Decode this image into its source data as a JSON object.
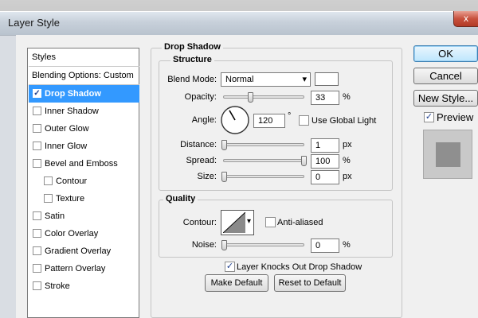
{
  "window": {
    "title": "Layer Style",
    "close_glyph": "x"
  },
  "sidebar": {
    "header": "Styles",
    "blending": "Blending Options: Custom",
    "items": [
      {
        "label": "Drop Shadow",
        "checked": true,
        "selected": true,
        "indent": false
      },
      {
        "label": "Inner Shadow",
        "checked": false,
        "indent": false
      },
      {
        "label": "Outer Glow",
        "checked": false,
        "indent": false
      },
      {
        "label": "Inner Glow",
        "checked": false,
        "indent": false
      },
      {
        "label": "Bevel and Emboss",
        "checked": false,
        "indent": false
      },
      {
        "label": "Contour",
        "checked": false,
        "indent": true
      },
      {
        "label": "Texture",
        "checked": false,
        "indent": true
      },
      {
        "label": "Satin",
        "checked": false,
        "indent": false
      },
      {
        "label": "Color Overlay",
        "checked": false,
        "indent": false
      },
      {
        "label": "Gradient Overlay",
        "checked": false,
        "indent": false
      },
      {
        "label": "Pattern Overlay",
        "checked": false,
        "indent": false
      },
      {
        "label": "Stroke",
        "checked": false,
        "indent": false
      }
    ]
  },
  "panel": {
    "title": "Drop Shadow",
    "structure": {
      "title": "Structure",
      "blend_mode_label": "Blend Mode:",
      "blend_mode_value": "Normal",
      "blend_color": "#ffffff",
      "opacity_label": "Opacity:",
      "opacity_value": "33",
      "opacity_unit": "%",
      "opacity_fraction": 0.33,
      "angle_label": "Angle:",
      "angle_value": "120",
      "angle_degrees": 120,
      "angle_unit": "°",
      "global_light_label": "Use Global Light",
      "global_light_checked": false,
      "distance_label": "Distance:",
      "distance_value": "1",
      "distance_unit": "px",
      "distance_fraction": 0.004,
      "spread_label": "Spread:",
      "spread_value": "100",
      "spread_unit": "%",
      "spread_fraction": 1.0,
      "size_label": "Size:",
      "size_value": "0",
      "size_unit": "px",
      "size_fraction": 0.0
    },
    "quality": {
      "title": "Quality",
      "contour_label": "Contour:",
      "anti_aliased_label": "Anti-aliased",
      "anti_aliased_checked": false,
      "noise_label": "Noise:",
      "noise_value": "0",
      "noise_unit": "%",
      "noise_fraction": 0.0
    },
    "knockout_label": "Layer Knocks Out Drop Shadow",
    "knockout_checked": true,
    "make_default": "Make Default",
    "reset_default": "Reset to Default"
  },
  "buttons": {
    "ok": "OK",
    "cancel": "Cancel",
    "new_style": "New Style...",
    "preview_label": "Preview",
    "preview_checked": true
  },
  "icons": {
    "checkmark": "✓",
    "dropdown": "▾",
    "close": "close-icon",
    "contour": "contour-icon"
  }
}
